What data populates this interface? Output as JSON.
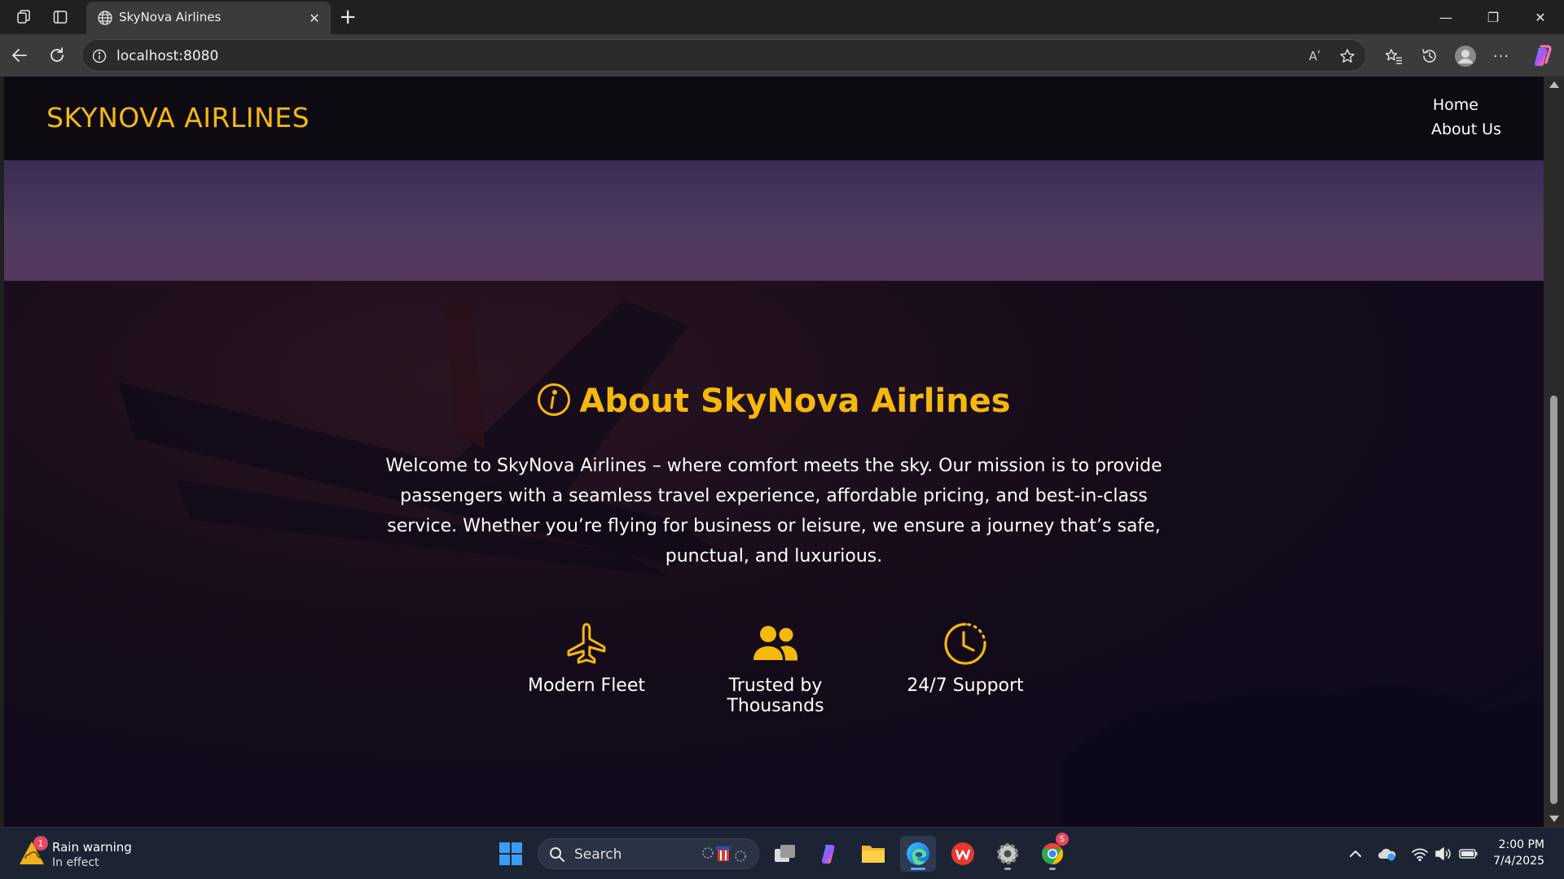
{
  "browser": {
    "tab_title": "SkyNova Airlines",
    "tab_close": "✕",
    "new_tab": "+",
    "address": "localhost:8080",
    "window_controls": {
      "minimize": "—",
      "restore": "❐",
      "close": "✕"
    },
    "read_aloud_label": "Aʹ",
    "more_label": "···"
  },
  "site": {
    "brand": "SKYNOVA AIRLINES",
    "nav": [
      {
        "label": "Home"
      },
      {
        "label": "About Us"
      }
    ],
    "about": {
      "title": "About SkyNova Airlines",
      "text": "Welcome to SkyNova Airlines – where comfort meets the sky. Our mission is to provide passengers with a seamless travel experience, affordable pricing, and best-in-class service. Whether you’re flying for business or leisure, we ensure a journey that’s safe, punctual, and luxurious."
    },
    "features": [
      {
        "icon": "airplane-icon",
        "label": "Modern Fleet"
      },
      {
        "icon": "users-icon",
        "label": "Trusted by Thousands"
      },
      {
        "icon": "clock-icon",
        "label": "24/7 Support"
      }
    ],
    "accent_color": "#f5b80c"
  },
  "taskbar": {
    "weather": {
      "title": "Rain warning",
      "subtitle": "In effect",
      "badge": "1"
    },
    "search_placeholder": "Search",
    "chrome_badge": "S",
    "clock": {
      "time": "2:00 PM",
      "date": "7/4/2025"
    }
  }
}
